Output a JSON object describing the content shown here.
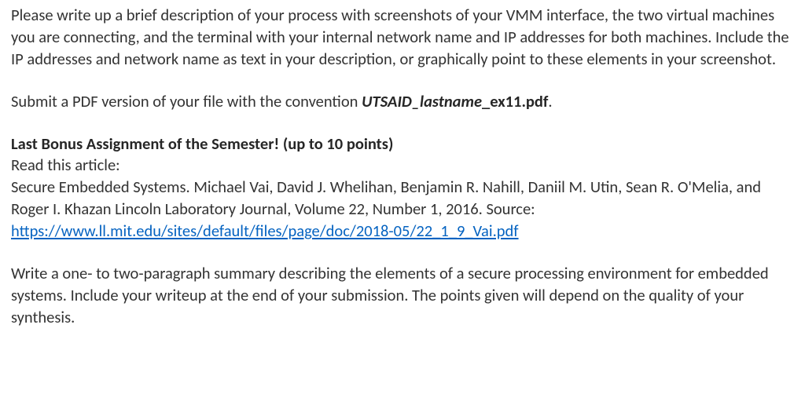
{
  "para1": "Please write up a brief description of your process with screenshots of your VMM interface, the two virtual machines you are connecting, and the terminal with your internal network name and IP addresses for both machines. Include the IP addresses and network name as text in your description, or graphically point to these elements in your screenshot.",
  "para2_pre": "Submit a PDF version of your file with the convention ",
  "para2_file_prefix": "UTSAID_lastname",
  "para2_file_suffix": "_ex11.pdf",
  "para2_post": ".",
  "bonus_heading": "Last Bonus Assignment of the Semester! (up to 10 points)",
  "bonus_read": "Read this article:",
  "citation": "Secure Embedded Systems. Michael Vai, David J. Whelihan, Benjamin R. Nahill, Daniil M. Utin, Sean R. O'Melia, and Roger I. Khazan Lincoln Laboratory Journal, Volume 22, Number 1, 2016. Source:",
  "link_text": "https://www.ll.mit.edu/sites/default/files/page/doc/2018-05/22_1_9_Vai.pdf",
  "link_href": "https://www.ll.mit.edu/sites/default/files/page/doc/2018-05/22_1_9_Vai.pdf",
  "para3": "Write a one- to two-paragraph summary describing the elements of a secure processing environment for embedded systems. Include your writeup at the end of your submission. The points given will depend on the quality of your synthesis."
}
